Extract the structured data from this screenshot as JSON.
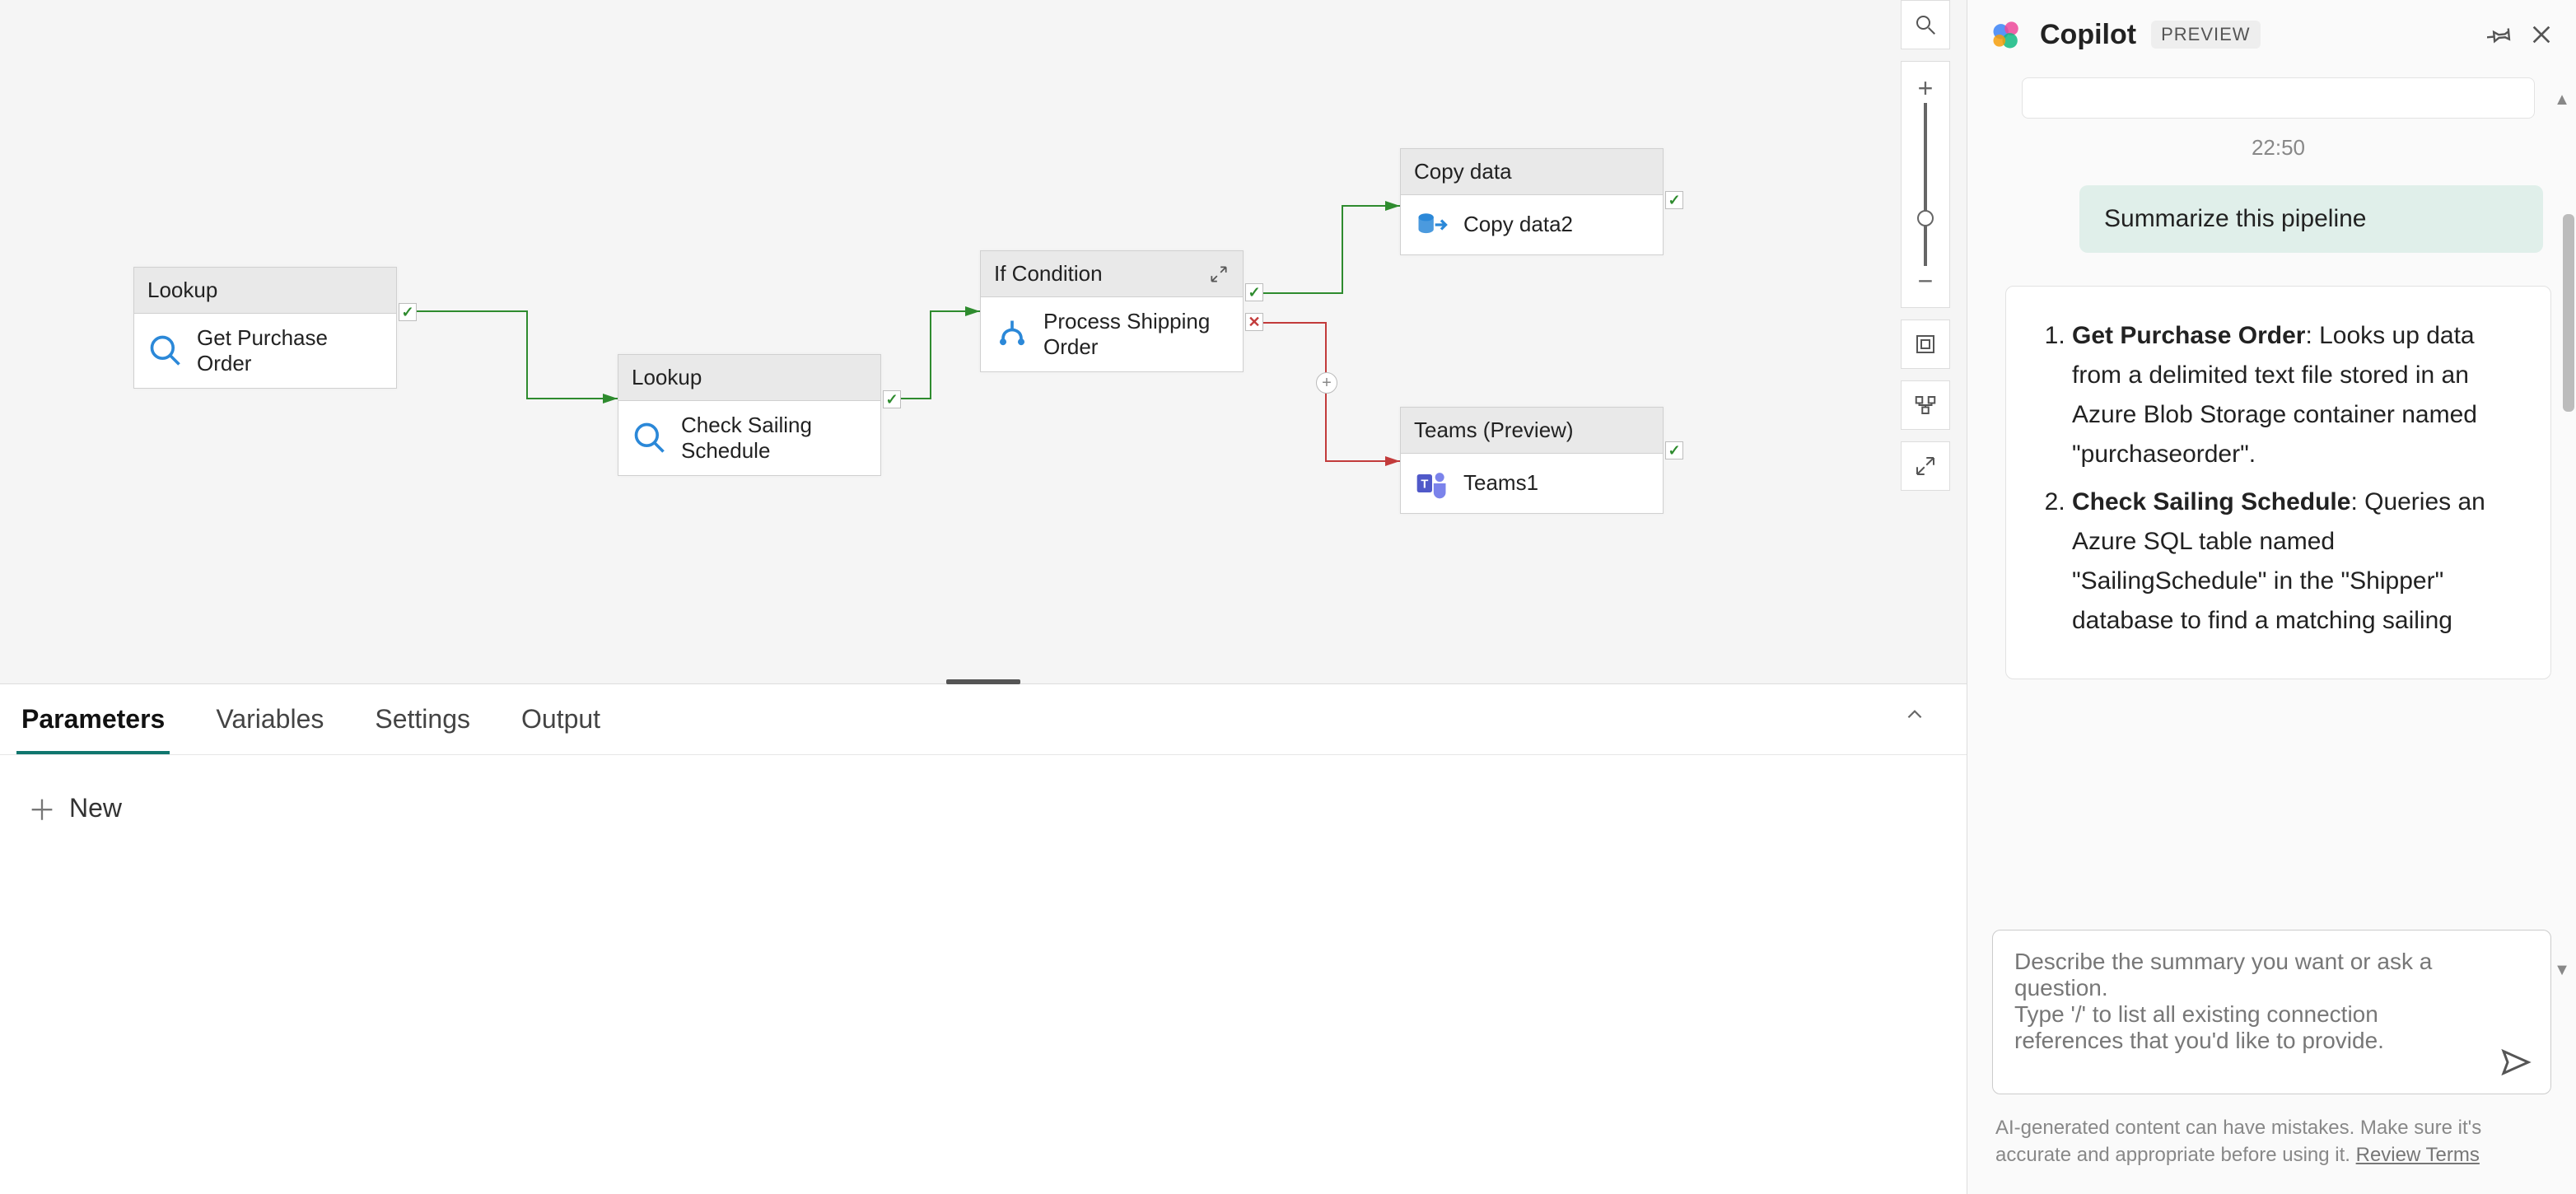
{
  "canvas": {
    "nodes": {
      "n1": {
        "type": "Lookup",
        "label": "Get Purchase Order"
      },
      "n2": {
        "type": "Lookup",
        "label": "Check Sailing Schedule"
      },
      "n3": {
        "type": "If Condition",
        "label": "Process Shipping Order"
      },
      "n4": {
        "type": "Copy data",
        "label": "Copy data2"
      },
      "n5": {
        "type": "Teams (Preview)",
        "label": "Teams1"
      }
    }
  },
  "bottom": {
    "tabs": {
      "t1": "Parameters",
      "t2": "Variables",
      "t3": "Settings",
      "t4": "Output"
    },
    "new_label": "New"
  },
  "copilot": {
    "title": "Copilot",
    "badge": "PREVIEW",
    "time": "22:50",
    "user_msg": "Summarize this pipeline",
    "answer": {
      "items": [
        {
          "bold": "Get Purchase Order",
          "rest": ": Looks up data from a delimited text file stored in an Azure Blob Storage container named \"purchaseorder\"."
        },
        {
          "bold": "Check Sailing Schedule",
          "rest": ": Queries an Azure SQL table named \"SailingSchedule\" in the \"Shipper\" database to find a matching sailing"
        }
      ]
    },
    "input_placeholder": "Describe the summary you want or ask a question.\nType '/' to list all existing connection references that you'd like to provide.",
    "footer_text": "AI-generated content can have mistakes. Make sure it's accurate and appropriate before using it. ",
    "footer_link": "Review Terms"
  }
}
